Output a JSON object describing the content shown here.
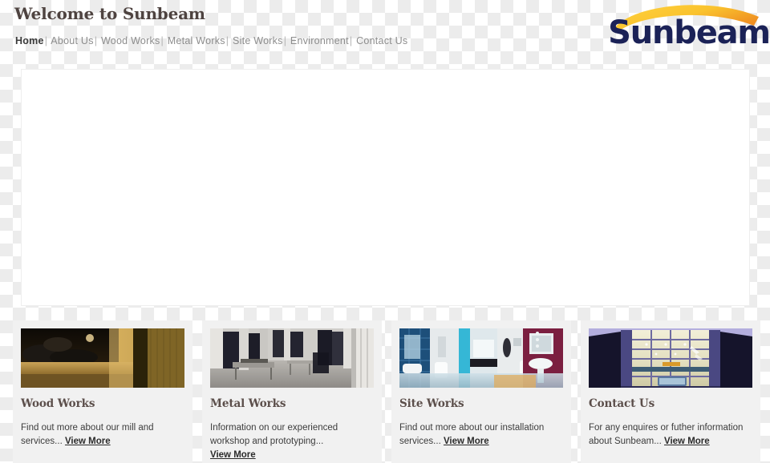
{
  "header": {
    "title": "Welcome to Sunbeam",
    "nav": {
      "separator": "|",
      "items": [
        {
          "label": "Home",
          "active": true
        },
        {
          "label": "About Us",
          "active": false
        },
        {
          "label": "Wood Works",
          "active": false
        },
        {
          "label": "Metal Works",
          "active": false
        },
        {
          "label": "Site Works",
          "active": false
        },
        {
          "label": "Environment",
          "active": false
        },
        {
          "label": "Contact Us",
          "active": false
        }
      ]
    }
  },
  "logo": {
    "text": "Sunbeam",
    "text_color": "#1b2257",
    "arc_color_start": "#ffd23f",
    "arc_color_end": "#ef8f22"
  },
  "stage": {
    "background": "#ffffff",
    "border_color": "#eeeeee"
  },
  "cards": [
    {
      "title": "Wood Works",
      "text": "Find out more about our mill and services...",
      "link": "View More",
      "image_name": "wood-works-thumbnail"
    },
    {
      "title": "Metal Works",
      "text": "Information on our experienced workshop and prototyping...",
      "link": "View More",
      "image_name": "metal-works-thumbnail"
    },
    {
      "title": "Site Works",
      "text": "Find out more about our installation services...",
      "link": "View More",
      "image_name": "site-works-thumbnail"
    },
    {
      "title": "Contact Us",
      "text": "For any enquires or futher information about Sunbeam...",
      "link": "View More",
      "image_name": "contact-us-thumbnail"
    }
  ],
  "colors": {
    "page_background_checker_light": "#ffffff",
    "page_background_checker_dark": "#ececec",
    "heading": "#4e4340",
    "card_background": "#f1f1f1",
    "card_title": "#5b4e4a",
    "nav_inactive": "#8d8d8d",
    "nav_active": "#3a3a3a"
  }
}
